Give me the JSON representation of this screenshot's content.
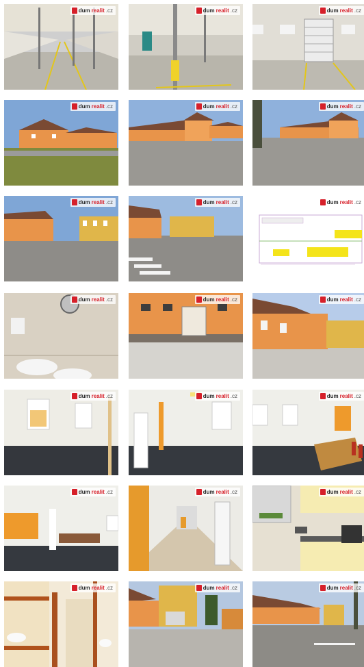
{
  "brand": {
    "part1": "dum",
    "part2": "realit",
    "part3": ".cz"
  },
  "colors": {
    "brand_red": "#d6202a",
    "building_orange": "#e8944a",
    "sky": "#7fa6d6"
  },
  "photos": [
    {
      "name": "photo-hall-interior-1"
    },
    {
      "name": "photo-hall-interior-2"
    },
    {
      "name": "photo-hall-gate"
    },
    {
      "name": "photo-building-lawn"
    },
    {
      "name": "photo-building-street"
    },
    {
      "name": "photo-building-street-2"
    },
    {
      "name": "photo-building-corner"
    },
    {
      "name": "photo-crossing"
    },
    {
      "name": "photo-floor-plan"
    },
    {
      "name": "photo-restroom-sink"
    },
    {
      "name": "photo-loading-door"
    },
    {
      "name": "photo-courtyard"
    },
    {
      "name": "photo-office-empty"
    },
    {
      "name": "photo-office-column"
    },
    {
      "name": "photo-office-table"
    },
    {
      "name": "photo-office-open"
    },
    {
      "name": "photo-corridor"
    },
    {
      "name": "photo-kitchenette"
    },
    {
      "name": "photo-bathroom"
    },
    {
      "name": "photo-yard"
    },
    {
      "name": "photo-street-view"
    }
  ]
}
